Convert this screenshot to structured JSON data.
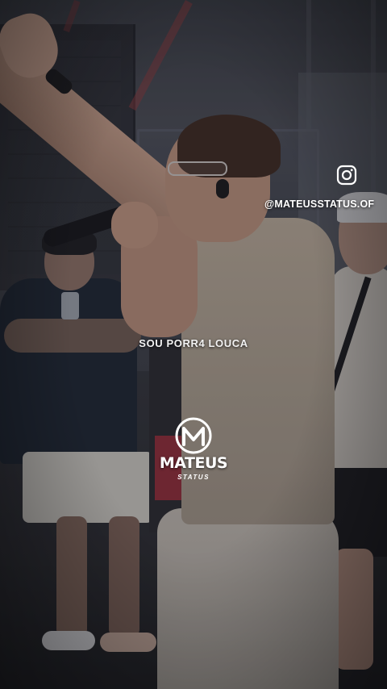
{
  "overlay": {
    "social_icon": "instagram-icon",
    "handle": "@MATEUSSTATUS.OF",
    "lyric": "SOU PORR4 LOUCA"
  },
  "logo": {
    "word": "MATEUS",
    "sub": "STATUS",
    "color": "#ffffff"
  }
}
